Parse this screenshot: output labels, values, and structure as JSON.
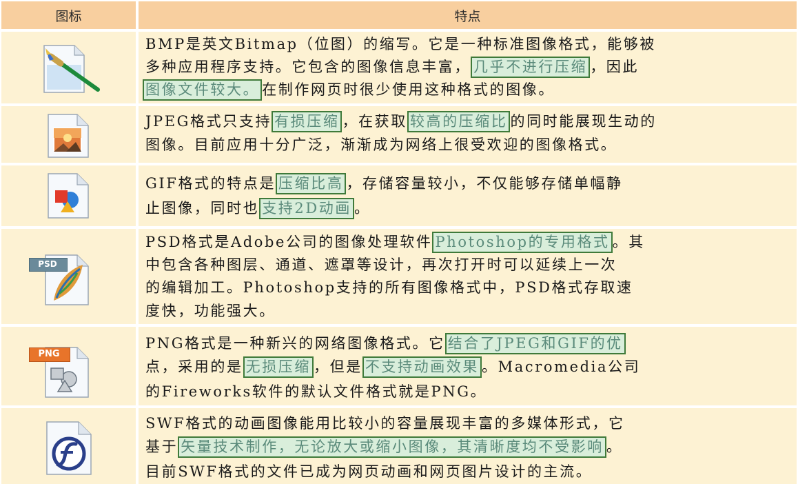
{
  "header": {
    "icon_col": "图标",
    "feature_col": "特点"
  },
  "rows": [
    {
      "format": "BMP",
      "icon": "bmp-paintbrush-icon",
      "lines": [
        [
          "BMP是英文Bitmap（位图）的缩写。它是一种标准图像格式，能够被"
        ],
        [
          "多种应用程序支持。它包含的图像信息丰富，",
          {
            "hl": "几乎不进行压缩"
          },
          "，因此"
        ],
        [
          {
            "hl": "图像文件较大。"
          },
          "在制作网页时很少使用这种格式的图像。"
        ]
      ]
    },
    {
      "format": "JPEG",
      "icon": "jpeg-photo-icon",
      "lines": [
        [
          "JPEG格式只支持",
          {
            "hl": "有损压缩"
          },
          "，在获取",
          {
            "hl": "较高的压缩比"
          },
          "的同时能展现生动的"
        ],
        [
          "图像。目前应用十分广泛，渐渐成为网络上很受欢迎的图像格式。"
        ]
      ]
    },
    {
      "format": "GIF",
      "icon": "gif-shapes-icon",
      "lines": [
        [
          "GIF格式的特点是",
          {
            "hl": "压缩比高"
          },
          "，存储容量较小，不仅能够存储单幅静"
        ],
        [
          "止图像，同时也",
          {
            "hl": "支持2D动画"
          },
          "。"
        ]
      ]
    },
    {
      "format": "PSD",
      "icon": "psd-feather-icon",
      "icon_label": "PSD",
      "lines": [
        [
          "PSD格式是Adobe公司的图像处理软件",
          {
            "hl": "Photoshop的专用格式"
          },
          "。其"
        ],
        [
          "中包含各种图层、通道、遮罩等设计，再次打开时可以延续上一次"
        ],
        [
          "的编辑加工。Photoshop支持的所有图像格式中，PSD格式存取速"
        ],
        [
          "度快，功能强大。"
        ]
      ]
    },
    {
      "format": "PNG",
      "icon": "png-shapes-icon",
      "icon_label": "PNG",
      "lines": [
        [
          "PNG格式是一种新兴的网络图像格式。它",
          {
            "hl": "结合了JPEG和GIF的优"
          }
        ],
        [
          "点，采用的是",
          {
            "hl": "无损压缩"
          },
          "，但是",
          {
            "hl": "不支持动画效果"
          },
          "。Macromedia公司"
        ],
        [
          "的Fireworks软件的默认文件格式就是PNG。"
        ]
      ]
    },
    {
      "format": "SWF",
      "icon": "swf-flash-icon",
      "lines": [
        [
          "SWF格式的动画图像能用比较小的容量展现丰富的多媒体形式，它"
        ],
        [
          "基于",
          {
            "hl": "矢量技术制作，无论放大或缩小图像，其清晰度均不受影响"
          },
          "。"
        ],
        [
          "目前SWF格式的文件已成为网页动画和网页图片设计的主流。"
        ]
      ]
    }
  ]
}
